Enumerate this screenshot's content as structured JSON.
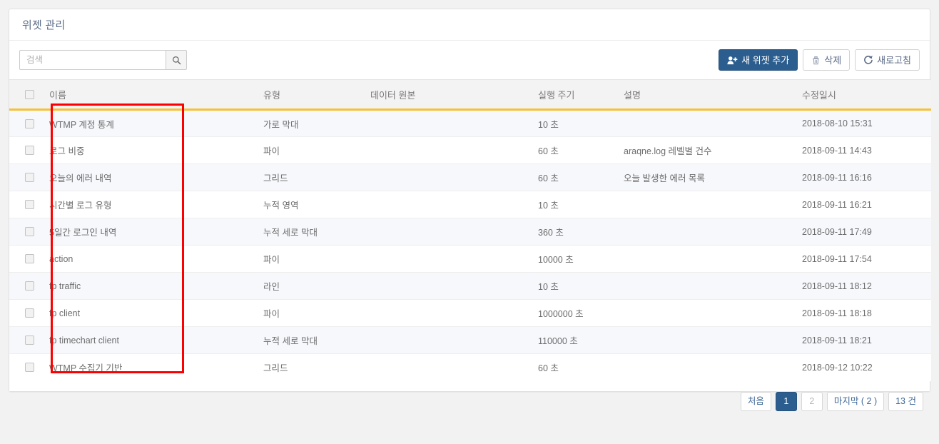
{
  "panel": {
    "title": "위젯 관리"
  },
  "search": {
    "placeholder": "검색",
    "value": "",
    "icon": "search-icon"
  },
  "toolbar": {
    "add_label": "새 위젯 추가",
    "add_icon": "user-plus-icon",
    "delete_label": "삭제",
    "delete_icon": "trash-icon",
    "refresh_label": "새로고침",
    "refresh_icon": "refresh-icon",
    "primary_color": "#2c5d8f"
  },
  "table": {
    "header_accent_color": "#f5c136",
    "columns": [
      {
        "key": "check",
        "label": ""
      },
      {
        "key": "name",
        "label": "이름"
      },
      {
        "key": "type",
        "label": "유형"
      },
      {
        "key": "source",
        "label": "데이터 원본"
      },
      {
        "key": "cycle",
        "label": "실행 주기"
      },
      {
        "key": "desc",
        "label": "설명"
      },
      {
        "key": "modified",
        "label": "수정일시"
      }
    ],
    "rows": [
      {
        "name": "WTMP 계정 통계",
        "type": "가로 막대",
        "source": "",
        "cycle": "10 초",
        "desc": "",
        "modified": "2018-08-10 15:31"
      },
      {
        "name": "로그 비중",
        "type": "파이",
        "source": "",
        "cycle": "60 초",
        "desc": "araqne.log 레벨별 건수",
        "modified": "2018-09-11 14:43"
      },
      {
        "name": "오늘의 에러 내역",
        "type": "그리드",
        "source": "",
        "cycle": "60 초",
        "desc": "오늘 발생한 에러 목록",
        "modified": "2018-09-11 16:16"
      },
      {
        "name": "시간별 로그 유형",
        "type": "누적 영역",
        "source": "",
        "cycle": "10 초",
        "desc": "",
        "modified": "2018-09-11 16:21"
      },
      {
        "name": "5일간 로그인 내역",
        "type": "누적 세로 막대",
        "source": "",
        "cycle": "360 초",
        "desc": "",
        "modified": "2018-09-11 17:49"
      },
      {
        "name": "action",
        "type": "파이",
        "source": "",
        "cycle": "10000 초",
        "desc": "",
        "modified": "2018-09-11 17:54"
      },
      {
        "name": "fp traffic",
        "type": "라인",
        "source": "",
        "cycle": "10 초",
        "desc": "",
        "modified": "2018-09-11 18:12"
      },
      {
        "name": "fp client",
        "type": "파이",
        "source": "",
        "cycle": "1000000 초",
        "desc": "",
        "modified": "2018-09-11 18:18"
      },
      {
        "name": "fp timechart client",
        "type": "누적 세로 막대",
        "source": "",
        "cycle": "110000 초",
        "desc": "",
        "modified": "2018-09-11 18:21"
      },
      {
        "name": "WTMP 수집기 기반",
        "type": "그리드",
        "source": "",
        "cycle": "60 초",
        "desc": "",
        "modified": "2018-09-12 10:22"
      }
    ]
  },
  "pagination": {
    "first_label": "처음",
    "pages": [
      {
        "label": "1",
        "active": true
      },
      {
        "label": "2",
        "active": false
      }
    ],
    "last_label": "마지막 ( 2 )",
    "count_label": "13 건"
  },
  "annotation": {
    "color": "#fb0000",
    "shape": "rectangle"
  }
}
